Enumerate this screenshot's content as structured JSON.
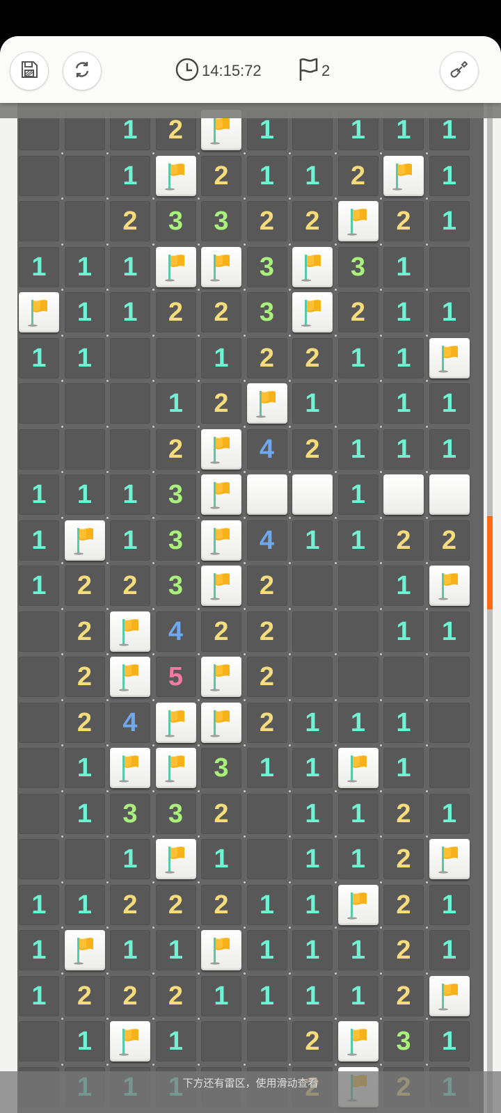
{
  "toolbar": {
    "save_icon": "save-icon",
    "restart_icon": "restart-icon",
    "clock_icon": "clock-icon",
    "timer": "14:15:72",
    "flag_icon": "flag-outline-icon",
    "flag_count": "2",
    "tool_icon": "shovel-icon"
  },
  "hint": "下方还有雷区，使用滑动查看",
  "colors": {
    "1": "#6ff1d2",
    "2": "#f7dc7e",
    "3": "#a9f07c",
    "4": "#6fa8ee",
    "5": "#f07aa0",
    "accent": "#ff6a13"
  },
  "board": {
    "rows": [
      [
        ".",
        ".",
        "1",
        "2",
        "F",
        "1",
        ".",
        "1",
        "1",
        "1"
      ],
      [
        ".",
        ".",
        "1",
        "F",
        "2",
        "1",
        "1",
        "2",
        "F",
        "1"
      ],
      [
        ".",
        ".",
        "2",
        "3",
        "3",
        "2",
        "2",
        "F",
        "2",
        "1"
      ],
      [
        "1",
        "1",
        "1",
        "F",
        "F",
        "3",
        "F",
        "3",
        "1",
        "."
      ],
      [
        "F",
        "1",
        "1",
        "2",
        "2",
        "3",
        "F",
        "2",
        "1",
        "1"
      ],
      [
        "1",
        "1",
        ".",
        ".",
        "1",
        "2",
        "2",
        "1",
        "1",
        "F"
      ],
      [
        ".",
        ".",
        ".",
        "1",
        "2",
        "F",
        "1",
        ".",
        "1",
        "1"
      ],
      [
        ".",
        ".",
        ".",
        "2",
        "F",
        "4",
        "2",
        "1",
        "1",
        "1"
      ],
      [
        "1",
        "1",
        "1",
        "3",
        "F",
        "U",
        "U",
        "1",
        "U",
        "U"
      ],
      [
        "1",
        "F",
        "1",
        "3",
        "F",
        "4",
        "1",
        "1",
        "2",
        "2"
      ],
      [
        "1",
        "2",
        "2",
        "3",
        "F",
        "2",
        ".",
        ".",
        "1",
        "F"
      ],
      [
        ".",
        "2",
        "F",
        "4",
        "2",
        "2",
        ".",
        ".",
        "1",
        "1"
      ],
      [
        ".",
        "2",
        "F",
        "5",
        "F",
        "2",
        ".",
        ".",
        ".",
        "."
      ],
      [
        ".",
        "2",
        "4",
        "F",
        "F",
        "2",
        "1",
        "1",
        "1",
        "."
      ],
      [
        ".",
        "1",
        "F",
        "F",
        "3",
        "1",
        "1",
        "F",
        "1",
        "."
      ],
      [
        ".",
        "1",
        "3",
        "3",
        "2",
        ".",
        "1",
        "1",
        "2",
        "1"
      ],
      [
        ".",
        ".",
        "1",
        "F",
        "1",
        ".",
        "1",
        "1",
        "2",
        "F"
      ],
      [
        "1",
        "1",
        "2",
        "2",
        "2",
        "1",
        "1",
        "F",
        "2",
        "1"
      ],
      [
        "1",
        "F",
        "1",
        "1",
        "F",
        "1",
        "1",
        "1",
        "2",
        "1"
      ],
      [
        "1",
        "2",
        "2",
        "2",
        "1",
        "1",
        "1",
        "1",
        "2",
        "F"
      ],
      [
        ".",
        "1",
        "F",
        "1",
        ".",
        ".",
        "2",
        "F",
        "3",
        "1"
      ],
      [
        ".",
        "1",
        "1",
        "1",
        ".",
        ".",
        "2",
        "F",
        "2",
        "1"
      ]
    ]
  }
}
